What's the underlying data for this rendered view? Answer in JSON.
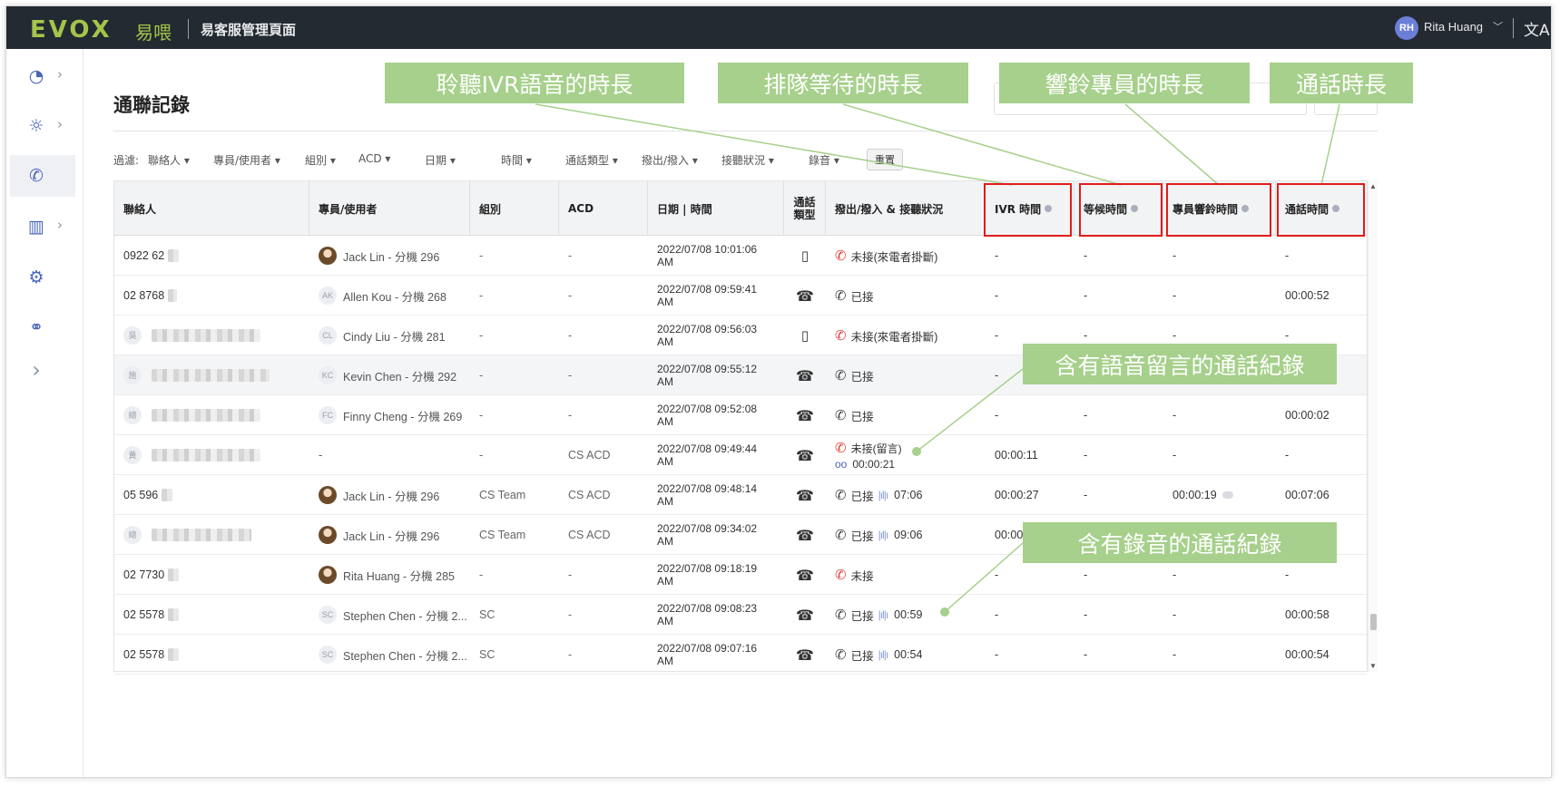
{
  "topbar": {
    "logo": "EVOX",
    "logo_cn": "易喂",
    "app_title": "易客服管理頁面",
    "user_initials": "RH",
    "user_name": "Rita Huang",
    "chevron": "﹀",
    "lang_icon": "文A"
  },
  "sidebar": {
    "items": [
      {
        "icon": "dashboard-icon",
        "glyph": "◔",
        "chevron": "›"
      },
      {
        "icon": "lightbulb-icon",
        "glyph": "☼",
        "chevron": "›"
      },
      {
        "icon": "call-log-icon",
        "glyph": "✆",
        "chevron": ""
      },
      {
        "icon": "bar-chart-icon",
        "glyph": "▥",
        "chevron": "›"
      },
      {
        "icon": "gear-icon",
        "glyph": "⚙",
        "chevron": ""
      },
      {
        "icon": "handshake-icon",
        "glyph": "⚭",
        "chevron": ""
      },
      {
        "icon": "expand-icon",
        "glyph": "›",
        "chevron": ""
      }
    ]
  },
  "page": {
    "title": "通聯記錄"
  },
  "filters": {
    "label": "過濾:",
    "items": [
      "聯絡人 ▾",
      "專員/使用者 ▾",
      "組別 ▾",
      "ACD ▾",
      "日期 ▾",
      "時間 ▾",
      "通話類型 ▾",
      "撥出/撥入 ▾",
      "接聽狀況 ▾",
      "錄音 ▾"
    ],
    "reset": "重置"
  },
  "table": {
    "headers": [
      "聯絡人",
      "專員/使用者",
      "組別",
      "ACD",
      "日期 | 時間",
      "通話\n類型",
      "撥出/撥入 & 接聽狀況",
      "IVR 時間",
      "等候時間",
      "專員響鈴時間",
      "通話時間"
    ],
    "rows": [
      {
        "contact_prefix": "",
        "contact": "0922 62",
        "agent": "Jack Lin - 分機 296",
        "agent_av": "photo",
        "group": "-",
        "acd": "-",
        "date": "2022/07/08 10:01:06",
        "ampm": "AM",
        "type": "mobile",
        "dir": "missed",
        "status": "未接(來電者掛斷)",
        "rec": "",
        "vm": "",
        "ivr": "-",
        "wait": "-",
        "ring": "-",
        "talk": "-"
      },
      {
        "contact_prefix": "",
        "contact": "02 8768",
        "agent": "Allen Kou - 分機 268",
        "agent_av": "AK",
        "group": "-",
        "acd": "-",
        "date": "2022/07/08 09:59:41",
        "ampm": "AM",
        "type": "phone",
        "dir": "answered",
        "status": "已接",
        "rec": "",
        "vm": "",
        "ivr": "-",
        "wait": "-",
        "ring": "-",
        "talk": "00:00:52"
      },
      {
        "contact_prefix": "吳",
        "contact": "吳",
        "agent": "Cindy Liu - 分機 281",
        "agent_av": "CL",
        "group": "-",
        "acd": "-",
        "date": "2022/07/08 09:56:03",
        "ampm": "AM",
        "type": "mobile",
        "dir": "missed",
        "status": "未接(來電者掛斷)",
        "rec": "",
        "vm": "",
        "ivr": "-",
        "wait": "-",
        "ring": "-",
        "talk": "-"
      },
      {
        "contact_prefix": "施",
        "contact": "施",
        "agent": "Kevin Chen - 分機 292",
        "agent_av": "KC",
        "group": "-",
        "acd": "-",
        "date": "2022/07/08 09:55:12",
        "ampm": "AM",
        "type": "phone",
        "dir": "answered",
        "status": "已接",
        "rec": "",
        "vm": "",
        "ivr": "-",
        "wait": "",
        "ring": "",
        "talk": ""
      },
      {
        "contact_prefix": "總",
        "contact": "總",
        "agent": "Finny Cheng - 分機 269",
        "agent_av": "FC",
        "group": "-",
        "acd": "-",
        "date": "2022/07/08 09:52:08",
        "ampm": "AM",
        "type": "phone",
        "dir": "answered",
        "status": "已接",
        "rec": "",
        "vm": "",
        "ivr": "-",
        "wait": "-",
        "ring": "-",
        "talk": "00:00:02"
      },
      {
        "contact_prefix": "黃",
        "contact": "黃",
        "agent": "-",
        "agent_av": "",
        "group": "-",
        "acd": "CS ACD",
        "date": "2022/07/08 09:49:44",
        "ampm": "AM",
        "type": "phone",
        "dir": "missed",
        "status": "未接(留言)",
        "rec": "",
        "vm": "00:00:21",
        "ivr": "00:00:11",
        "wait": "-",
        "ring": "-",
        "talk": "-"
      },
      {
        "contact_prefix": "",
        "contact": "05 596",
        "agent": "Jack Lin - 分機 296",
        "agent_av": "photo",
        "group": "CS Team",
        "acd": "CS ACD",
        "date": "2022/07/08 09:48:14",
        "ampm": "AM",
        "type": "phone",
        "dir": "answered",
        "status": "已接",
        "rec": "07:06",
        "vm": "",
        "ivr": "00:00:27",
        "wait": "-",
        "ring": "00:00:19",
        "talk": "00:07:06"
      },
      {
        "contact_prefix": "總",
        "contact": "總",
        "agent": "Jack Lin - 分機 296",
        "agent_av": "photo",
        "group": "CS Team",
        "acd": "CS ACD",
        "date": "2022/07/08 09:34:02",
        "ampm": "AM",
        "type": "phone",
        "dir": "answered",
        "status": "已接",
        "rec": "09:06",
        "vm": "",
        "ivr": "00:00",
        "wait": "",
        "ring": "",
        "talk": ""
      },
      {
        "contact_prefix": "",
        "contact": "02 7730",
        "agent": "Rita Huang - 分機 285",
        "agent_av": "photo",
        "group": "-",
        "acd": "-",
        "date": "2022/07/08 09:18:19",
        "ampm": "AM",
        "type": "phone",
        "dir": "missed",
        "status": "未接",
        "rec": "",
        "vm": "",
        "ivr": "-",
        "wait": "-",
        "ring": "-",
        "talk": "-"
      },
      {
        "contact_prefix": "",
        "contact": "02 5578",
        "agent": "Stephen Chen - 分機 2...",
        "agent_av": "SC",
        "group": "SC",
        "acd": "-",
        "date": "2022/07/08 09:08:23",
        "ampm": "AM",
        "type": "phone",
        "dir": "answered",
        "status": "已接",
        "rec": "00:59",
        "vm": "",
        "ivr": "-",
        "wait": "-",
        "ring": "-",
        "talk": "00:00:58"
      },
      {
        "contact_prefix": "",
        "contact": "02 5578",
        "agent": "Stephen Chen - 分機 2...",
        "agent_av": "SC",
        "group": "SC",
        "acd": "-",
        "date": "2022/07/08 09:07:16",
        "ampm": "AM",
        "type": "phone",
        "dir": "answered",
        "status": "已接",
        "rec": "00:54",
        "vm": "",
        "ivr": "-",
        "wait": "-",
        "ring": "-",
        "talk": "00:00:54"
      }
    ]
  },
  "annotations": {
    "ivr": "聆聽IVR語音的時長",
    "queue": "排隊等待的時長",
    "ring": "響鈴專員的時長",
    "talk": "通話時長",
    "voicemail": "含有語音留言的通話紀錄",
    "recording": "含有錄音的通話紀錄"
  },
  "colors": {
    "topbar": "#232a31",
    "brand": "#a5c44a",
    "callout": "#a6d08b",
    "highlight": "#e21b1b",
    "missed": "#e0403a",
    "accent": "#4a65b8"
  }
}
